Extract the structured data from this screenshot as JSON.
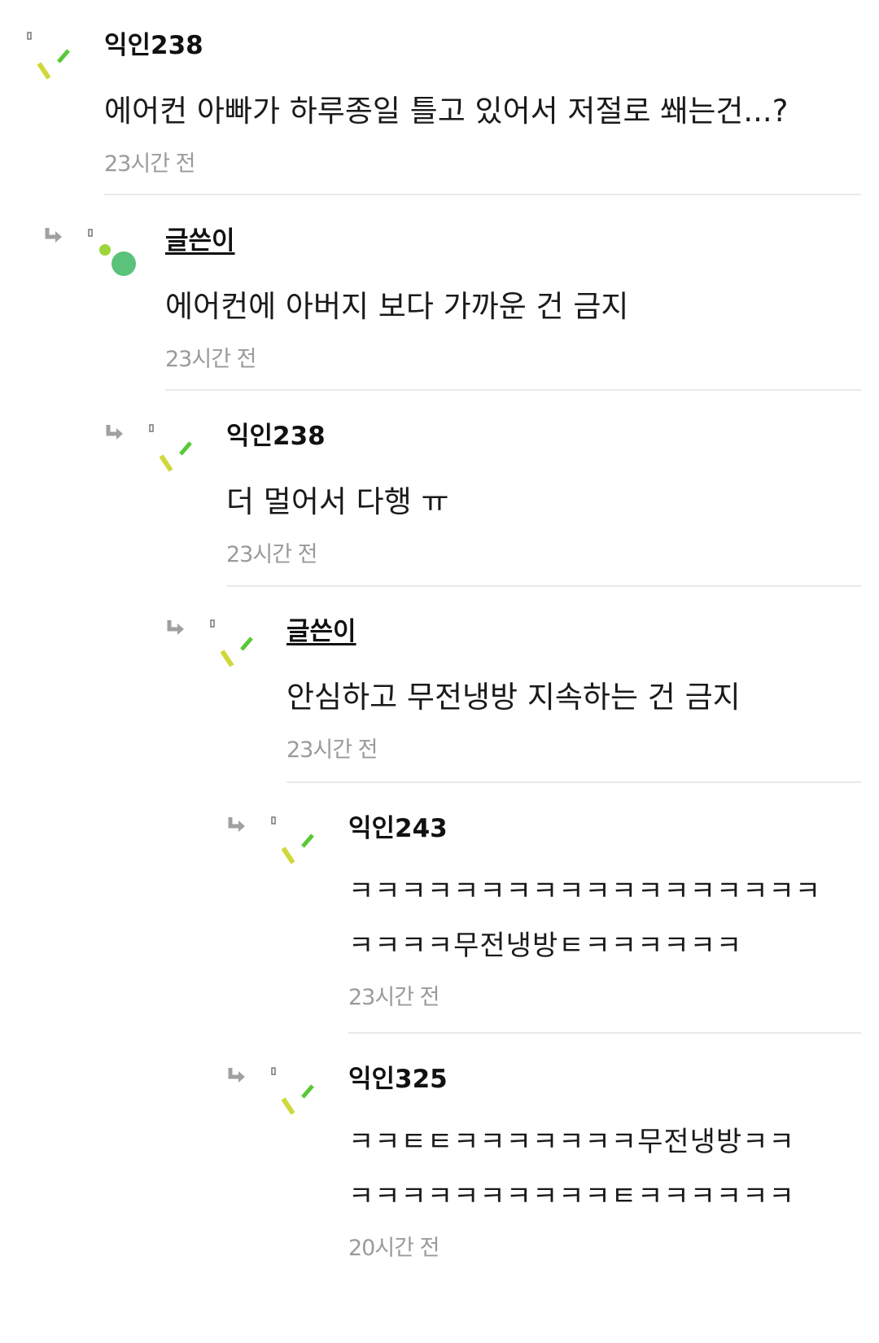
{
  "colors": {
    "text": "#111111",
    "muted": "#9a9a9a",
    "divider": "#e9e9e9",
    "avatar_green": "#5ac27a",
    "avatar_lime": "#9ed63a",
    "avatar_yellow": "#cfd83a",
    "avatar_dash_green": "#58c936",
    "reply_arrow": "#a0a0a0"
  },
  "comments": [
    {
      "author": "익인238",
      "is_op": false,
      "avatar": "dash-avatar-icon",
      "lines": [
        "에어컨 아빠가 하루종일 틀고 있어서 저절로 쐐는건...?"
      ],
      "time": "23시간 전"
    },
    {
      "author": "글쓴이",
      "is_op": true,
      "avatar": "circle-avatar-icon",
      "lines": [
        "에어컨에 아버지 보다 가까운 건 금지"
      ],
      "time": "23시간 전"
    },
    {
      "author": "익인238",
      "is_op": false,
      "avatar": "dash-avatar-icon",
      "lines": [
        "더 멀어서 다행 ㅠ"
      ],
      "time": "23시간 전"
    },
    {
      "author": "글쓴이",
      "is_op": true,
      "avatar": "dash-avatar-icon",
      "lines": [
        "안심하고 무전냉방 지속하는 건 금지"
      ],
      "time": "23시간 전"
    },
    {
      "author": "익인243",
      "is_op": false,
      "avatar": "dash-avatar-icon",
      "lines": [
        "ㅋㅋㅋㅋㅋㅋㅋㅋㅋㅋㅋㅋㅋㅋㅋㅋㅋㅋ",
        "ㅋㅋㅋㅋ무전냉방ㅌㅋㅋㅋㅋㅋㅋ"
      ],
      "time": "23시간 전"
    },
    {
      "author": "익인325",
      "is_op": false,
      "avatar": "dash-avatar-icon",
      "lines": [
        "ㅋㅋㅌㅌㅋㅋㅋㅋㅋㅋㅋ무전냉방ㅋㅋ",
        "ㅋㅋㅋㅋㅋㅋㅋㅋㅋㅋㅌㅋㅋㅋㅋㅋㅋ"
      ],
      "time": "20시간 전"
    }
  ]
}
